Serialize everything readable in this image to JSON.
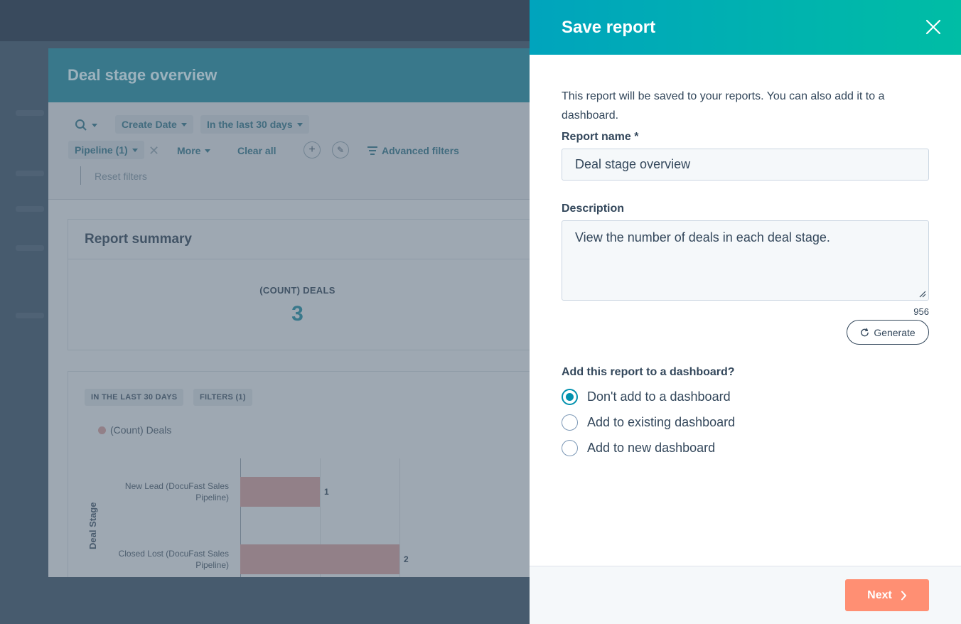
{
  "background": {
    "modal_title": "Deal stage overview",
    "filters": {
      "create_date": "Create Date",
      "date_range": "In the last 30 days",
      "pipeline": "Pipeline (1)",
      "more": "More",
      "clear_all": "Clear all",
      "advanced_filters": "Advanced filters",
      "reset_filters": "Reset filters"
    },
    "summary": {
      "title": "Report summary",
      "metric_label": "(COUNT) DEALS",
      "metric_value": "3"
    },
    "chart_tags": [
      "IN THE LAST 30 DAYS",
      "FILTERS (1)"
    ]
  },
  "chart_data": {
    "type": "bar",
    "orientation": "horizontal",
    "categories": [
      "New Lead (DocuFast Sales Pipeline)",
      "Closed Lost (DocuFast Sales Pipeline)"
    ],
    "category_lines": [
      [
        "New Lead (DocuFast Sales",
        "Pipeline)"
      ],
      [
        "Closed Lost (DocuFast Sales",
        "Pipeline)"
      ]
    ],
    "series": [
      {
        "name": "(Count) Deals",
        "values": [
          1,
          2
        ]
      }
    ],
    "ylabel": "Deal Stage",
    "xlim": [
      0,
      2
    ],
    "bar_color": "#b99a9e"
  },
  "panel": {
    "title": "Save report",
    "intro": "This report will be saved to your reports. You can also add it to a dashboard.",
    "name_label": "Report name *",
    "name_value": "Deal stage overview",
    "description_label": "Description",
    "description_value": "View the number of deals in each deal stage.",
    "char_count": "956",
    "generate_label": "Generate",
    "dashboard_question": "Add this report to a dashboard?",
    "dashboard_options": [
      {
        "label": "Don't add to a dashboard",
        "checked": true
      },
      {
        "label": "Add to existing dashboard",
        "checked": false
      },
      {
        "label": "Add to new dashboard",
        "checked": false
      }
    ],
    "next_label": "Next"
  },
  "colors": {
    "header_gradient_start": "#00a4bd",
    "header_gradient_end": "#00bda5",
    "primary_button": "#ff8f73",
    "radio_accent": "#0091ae",
    "text": "#33475b"
  },
  "icons": {
    "close": "close-icon",
    "generate": "refresh-sparkle-icon",
    "next": "chevron-right-icon",
    "search": "search-icon"
  }
}
